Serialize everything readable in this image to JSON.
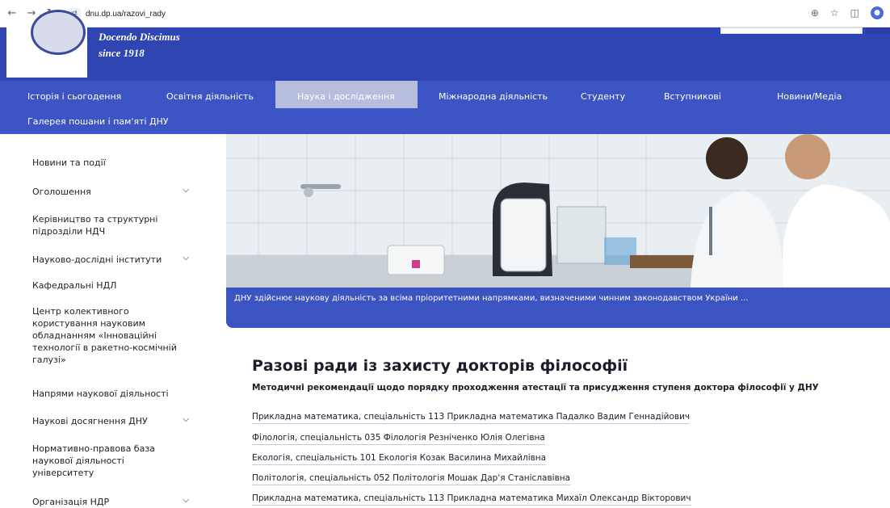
{
  "browser": {
    "url": "dnu.dp.ua/razovi_rady"
  },
  "header": {
    "motto_line1": "Docendo Discimus",
    "motto_line2": "since 1918"
  },
  "nav": {
    "items": [
      {
        "label": "Історія і сьогодення"
      },
      {
        "label": "Освітня діяльність"
      },
      {
        "label": "Наука і дослідження"
      },
      {
        "label": "Міжнародна діяльність"
      },
      {
        "label": "Студенту"
      },
      {
        "label": "Вступникові"
      },
      {
        "label": "Новини/Медіа"
      },
      {
        "label": "Галерея пошани і пам'яті ДНУ"
      }
    ],
    "active_index": 2
  },
  "sidebar": {
    "items": [
      {
        "label": "Новини та події"
      },
      {
        "label": "Оголошення"
      },
      {
        "label": "Керівництво та структурні підрозділи НДЧ"
      },
      {
        "label": "Науково-дослідні інститути"
      },
      {
        "label": "Кафедральні НДЛ"
      },
      {
        "label": "Центр колективного користування науковим обладнанням «Інноваційні технології в ракетно-космічній галузі»"
      },
      {
        "label": "Напрями наукової діяльності"
      },
      {
        "label": "Наукові досягнення ДНУ"
      },
      {
        "label": "Нормативно-правова база наукової діяльності університету"
      },
      {
        "label": "Організація НДР"
      }
    ]
  },
  "hero": {
    "caption": "ДНУ здійснює наукову діяльність за всіма пріоритетними напрямками, визначеними чинним законодавством України ..."
  },
  "content": {
    "title": "Разові ради із захисту докторів філософії",
    "subtitle": "Методичні рекомендації щодо порядку проходження атестації та присудження ступеня доктора філософії у ДНУ",
    "links": [
      {
        "label": "Прикладна математика, спеціальність 113 Прикладна математика Падалко Вадим Геннадійович"
      },
      {
        "label": "Філологія, спеціальність 035 Філологія Резніченко Юлія Олегівна"
      },
      {
        "label": "Екологія, спеціальність 101 Екологія Козак Василина Михайлівна"
      },
      {
        "label": "Політологія, спеціальність 052 Політологія Мошак Дар'я Станіславівна"
      },
      {
        "label": "Прикладна математика, спеціальність 113 Прикладна математика Михаїл Олександр Вікторович"
      }
    ]
  },
  "colors": {
    "header_bg": "#2f45b1",
    "nav_bg": "#3d54c4",
    "nav_active_bg": "#b7bedd",
    "hero_caption_bg": "#3c53c2"
  }
}
